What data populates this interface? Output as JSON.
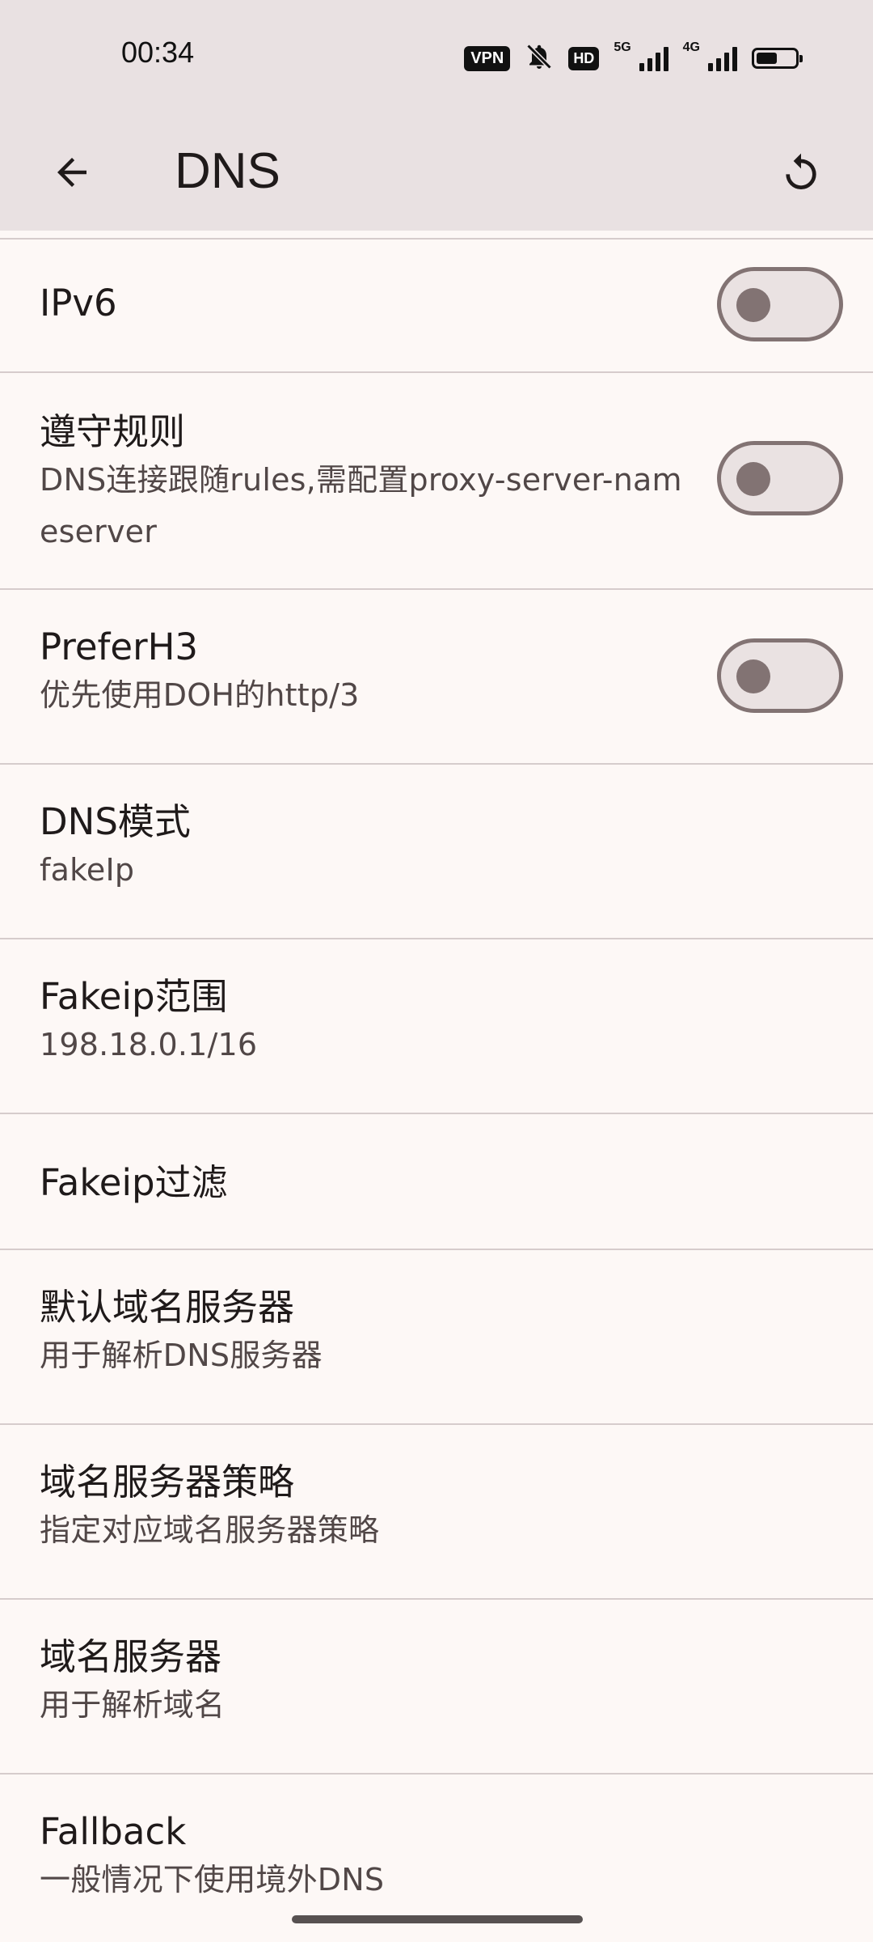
{
  "status_bar": {
    "time": "00:34",
    "vpn_badge": "VPN",
    "hd_badge": "HD",
    "network_5g": "5G",
    "network_4g": "4G",
    "battery_level_percent": 55
  },
  "app_bar": {
    "title": "DNS",
    "back_icon": "arrow-back-icon",
    "reset_icon": "refresh-icon"
  },
  "settings": {
    "ipv6": {
      "title": "IPv6",
      "enabled": false
    },
    "respect_rules": {
      "title": "遵守规则",
      "subtitle": "DNS连接跟随rules,需配置proxy-server-nameserver",
      "enabled": false
    },
    "prefer_h3": {
      "title": "PreferH3",
      "subtitle": "优先使用DOH的http/3",
      "enabled": false
    },
    "dns_mode": {
      "title": "DNS模式",
      "subtitle": "fakeIp"
    },
    "fakeip_range": {
      "title": "Fakeip范围",
      "subtitle": "198.18.0.1/16"
    },
    "fakeip_filter": {
      "title": "Fakeip过滤"
    },
    "default_nameserver": {
      "title": "默认域名服务器",
      "subtitle": "用于解析DNS服务器"
    },
    "nameserver_policy": {
      "title": "域名服务器策略",
      "subtitle": "指定对应域名服务器策略"
    },
    "nameserver": {
      "title": "域名服务器",
      "subtitle": "用于解析域名"
    },
    "fallback": {
      "title": "Fallback",
      "subtitle": "一般情况下使用境外DNS"
    }
  },
  "colors": {
    "background": "#FDF8F6",
    "app_bar": "#E9E1E2",
    "divider": "#D6CCCC",
    "switch_outline": "#827373"
  }
}
